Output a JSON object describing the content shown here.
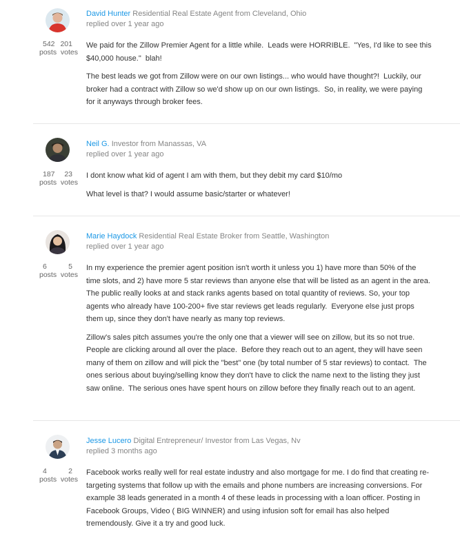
{
  "posts": [
    {
      "author": "David Hunter",
      "title": "Residential Real Estate Agent from Cleveland, Ohio",
      "replied": "replied over 1 year ago",
      "posts_count": "542",
      "votes_count": "201",
      "posts_label": "posts",
      "votes_label": "votes",
      "paragraphs": [
        "We paid for the Zillow Premier Agent for a little while.  Leads were HORRIBLE.  \"Yes, I'd like to see this $40,000 house.\"  blah!",
        "The best leads we got from Zillow were on our own listings... who would have thought?!  Luckily, our broker had a contract with Zillow so we'd show up on our own listings.  So, in reality, we were paying for it anyways through broker fees."
      ]
    },
    {
      "author": "Neil G.",
      "title": "Investor from Manassas, VA",
      "replied": "replied over 1 year ago",
      "posts_count": "187",
      "votes_count": "23",
      "posts_label": "posts",
      "votes_label": "votes",
      "paragraphs": [
        "I dont know what kid of agent I am with them, but they debit my card $10/mo",
        "What level is that? I would assume basic/starter or whatever!"
      ]
    },
    {
      "author": "Marie Haydock",
      "title": "Residential Real Estate Broker from Seattle, Washington",
      "replied": "replied over 1 year ago",
      "posts_count": "6",
      "votes_count": "5",
      "posts_label": "posts",
      "votes_label": "votes",
      "paragraphs": [
        "In my experience the premier agent position isn't worth it unless you 1) have more than 50% of the time slots, and 2) have more 5 star reviews than anyone else that will be listed as an agent in the area.  The public really looks at and stack ranks agents based on total quantity of reviews. So, your top agents who already have 100-200+ five star reviews get leads regularly.  Everyone else just props them up, since they don't have nearly as many top reviews.",
        "Zillow's sales pitch assumes you're the only one that a viewer will see on zillow, but its so not true.  People are clicking around all over the place.  Before they reach out to an agent, they will have seen many of them on zillow and will pick the \"best\" one (by total number of 5 star reviews) to contact.  The ones serious about buying/selling know they don't have to click the name next to the listing they just saw online.  The serious ones have spent hours on zillow before they finally reach out to an agent."
      ]
    },
    {
      "author": "Jesse Lucero",
      "title": "Digital Entrepreneur/ Investor from Las Vegas, Nv",
      "replied": "replied 3 months ago",
      "posts_count": "4",
      "votes_count": "2",
      "posts_label": "posts",
      "votes_label": "votes",
      "paragraphs": [
        "Facebook works really well for real estate industry and also mortgage for me. I do find that creating re-targeting systems that follow up with the emails and phone numbers are increasing conversions. For example 38 leads generated in a month 4 of these leads in processing with a loan officer. Posting in Facebook Groups, Video ( BIG WINNER) and using infusion soft for email has also helped tremendously. Give it a try and good luck."
      ]
    }
  ]
}
